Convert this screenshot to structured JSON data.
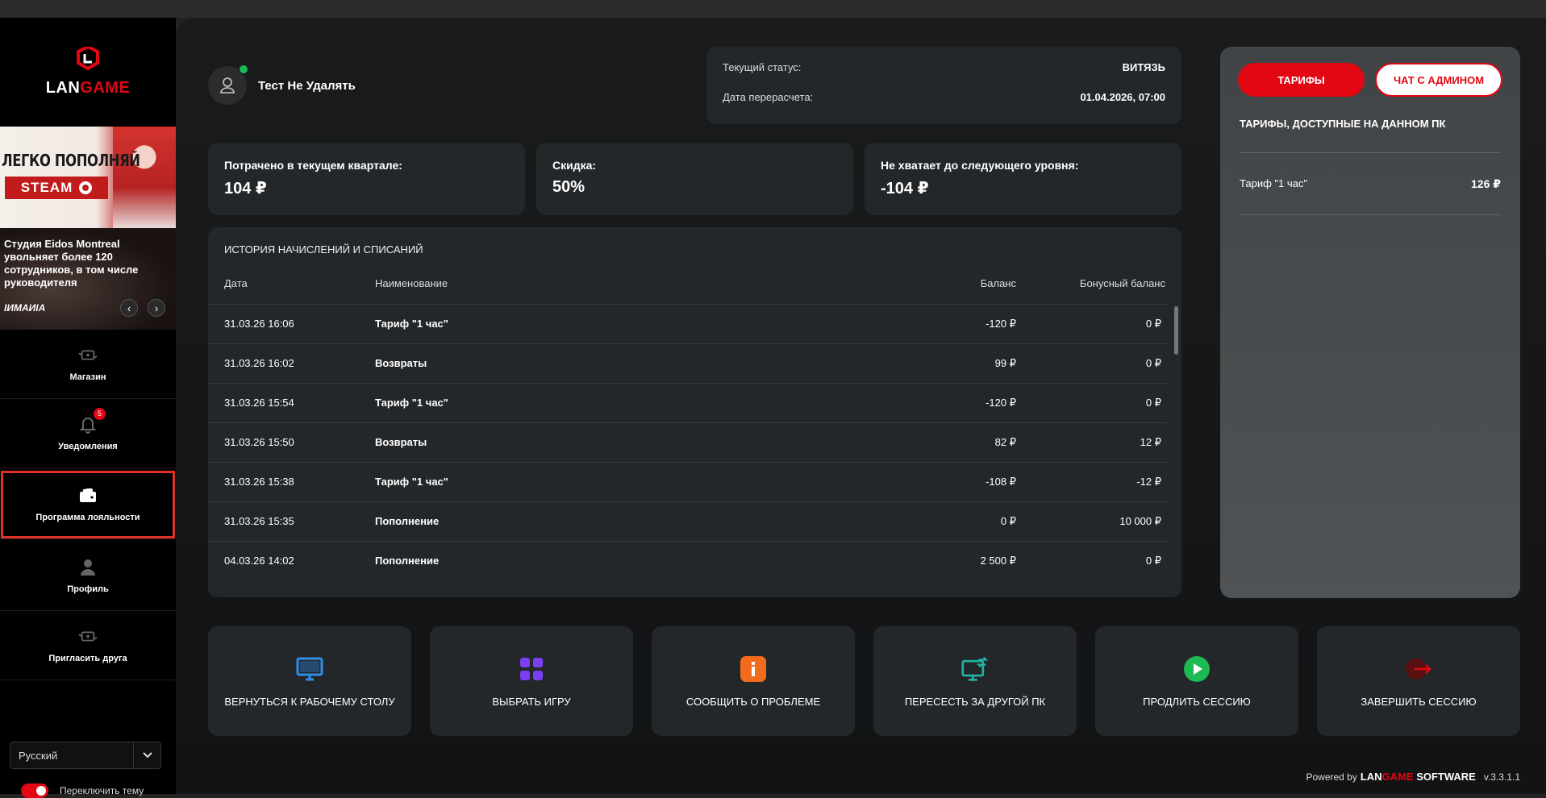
{
  "brand": {
    "logo_lan": "LAN",
    "logo_game": "GAME"
  },
  "promo": {
    "title": "ЛЕГКО ПОПОЛНЯЙ",
    "steam": "STEAM",
    "news": "Студия Eidos Montreal увольняет более 120 сотрудников, в том числе руководителя",
    "source": "IИMAИIA",
    "prev": "‹",
    "next": "›"
  },
  "sidebar": {
    "items": [
      {
        "label": "Магазин",
        "icon": "shop-icon"
      },
      {
        "label": "Уведомления",
        "icon": "bell-icon",
        "badge": "5"
      },
      {
        "label": "Программа лояльности",
        "icon": "wallet-icon",
        "active": true
      },
      {
        "label": "Профиль",
        "icon": "user-icon"
      },
      {
        "label": "Пригласить друга",
        "icon": "invite-icon"
      }
    ],
    "language": "Русский",
    "theme_toggle_label": "Переключить тему"
  },
  "user": {
    "name": "Тест Не Удалять"
  },
  "status": {
    "current_label": "Текущий статус:",
    "current_value": "ВИТЯЗЬ",
    "recalc_label": "Дата перерасчета:",
    "recalc_value": "01.04.2026, 07:00"
  },
  "stats": [
    {
      "label": "Потрачено в текущем квартале:",
      "value": "104 ₽"
    },
    {
      "label": "Скидка:",
      "value": "50%"
    },
    {
      "label": "Не хватает до следующего уровня:",
      "value": "-104 ₽"
    }
  ],
  "history": {
    "title": "ИСТОРИЯ НАЧИСЛЕНИЙ И СПИСАНИЙ",
    "headers": {
      "date": "Дата",
      "name": "Наименование",
      "balance": "Баланс",
      "bonus": "Бонусный баланс"
    },
    "rows": [
      {
        "date": "31.03.26 16:06",
        "name": "Тариф \"1 час\"",
        "balance": "-120 ₽",
        "bonus": "0 ₽"
      },
      {
        "date": "31.03.26 16:02",
        "name": "Возвраты",
        "balance": "99 ₽",
        "bonus": "0 ₽"
      },
      {
        "date": "31.03.26 15:54",
        "name": "Тариф \"1 час\"",
        "balance": "-120 ₽",
        "bonus": "0 ₽"
      },
      {
        "date": "31.03.26 15:50",
        "name": "Возвраты",
        "balance": "82 ₽",
        "bonus": "12 ₽"
      },
      {
        "date": "31.03.26 15:38",
        "name": "Тариф \"1 час\"",
        "balance": "-108 ₽",
        "bonus": "-12 ₽"
      },
      {
        "date": "31.03.26 15:35",
        "name": "Пополнение",
        "balance": "0 ₽",
        "bonus": "10 000 ₽"
      },
      {
        "date": "04.03.26 14:02",
        "name": "Пополнение",
        "balance": "2 500 ₽",
        "bonus": "0 ₽"
      }
    ]
  },
  "tariffs": {
    "tariffs_button": "ТАРИФЫ",
    "chat_button": "ЧАТ С АДМИНОМ",
    "title": "ТАРИФЫ, ДОСТУПНЫЕ НА ДАННОМ ПК",
    "items": [
      {
        "name": "Тариф \"1 час\"",
        "price": "126 ₽"
      }
    ]
  },
  "actions": [
    {
      "label": "ВЕРНУТЬСЯ К РАБОЧЕМУ СТОЛУ",
      "icon": "monitor-icon",
      "color": "#2f8fe8"
    },
    {
      "label": "ВЫБРАТЬ ИГРУ",
      "icon": "grid-icon",
      "color": "#7b3ff2"
    },
    {
      "label": "СООБЩИТЬ О ПРОБЛЕМЕ",
      "icon": "info-icon",
      "color": "#f26b1d"
    },
    {
      "label": "ПЕРЕСЕСТЬ ЗА ДРУГОЙ ПК",
      "icon": "switch-pc-icon",
      "color": "#1fb5a0"
    },
    {
      "label": "ПРОДЛИТЬ СЕССИЮ",
      "icon": "play-icon",
      "color": "#1db954"
    },
    {
      "label": "ЗАВЕРШИТЬ СЕССИЮ",
      "icon": "logout-icon",
      "color": "#e30613"
    }
  ],
  "footer": {
    "powered": "Powered by",
    "lan": "LAN",
    "game": "GAME",
    "software": "SOFTWARE",
    "version": "v.3.3.1.1"
  },
  "colors": {
    "accent": "#e30613",
    "card": "#24272a",
    "sidebar": "#000000"
  }
}
